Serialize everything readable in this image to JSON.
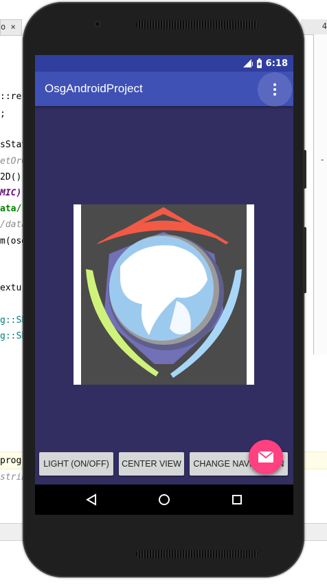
{
  "ide": {
    "left_tab": "o ×",
    "right_tab": "4",
    "right_panel_mark": "-",
    "code_lines": [
      {
        "text": "::re",
        "color": "#000000",
        "italic": false,
        "bold": false
      },
      {
        "text": ";",
        "color": "#000000",
        "italic": false,
        "bold": false
      },
      {
        "text": "sStat",
        "color": "#000000",
        "italic": false,
        "bold": false
      },
      {
        "text": "etOrC",
        "color": "#8c8c8c",
        "italic": true,
        "bold": false
      },
      {
        "text": "2D();",
        "color": "#000000",
        "italic": false,
        "bold": false
      },
      {
        "text": "MIC)",
        "color": "#660e7a",
        "italic": true,
        "bold": true
      },
      {
        "text": "ata/",
        "color": "#008000",
        "italic": false,
        "bold": true
      },
      {
        "text": "/data",
        "color": "#8c8c8c",
        "italic": true,
        "bold": false
      },
      {
        "text": "m(osg",
        "color": "#000000",
        "italic": false,
        "bold": false
      },
      {
        "text": "extur",
        "color": "#000000",
        "italic": false,
        "bold": false
      },
      {
        "text": "g::Sh",
        "color": "#008080",
        "italic": false,
        "bold": false
      },
      {
        "text": "g::Sh",
        "color": "#008080",
        "italic": false,
        "bold": false
      },
      {
        "text": "prog)",
        "color": "#000000",
        "italic": false,
        "bold": false
      },
      {
        "text": "stribu",
        "color": "#8c8c8c",
        "italic": true,
        "bold": false
      }
    ]
  },
  "status_bar": {
    "time": "6:18",
    "signal_icon": "signal-icon",
    "battery_icon": "battery-charging-icon"
  },
  "app_bar": {
    "title": "OsgAndroidProject",
    "menu_icon": "overflow-menu-icon"
  },
  "render_view": {
    "description_icon": "osg-globe-logo",
    "colors": {
      "background": "#4b4b4b",
      "roof": "#f25a45",
      "hexagon": "#7270b7",
      "left_swoosh": "#cff27a",
      "right_swoosh": "#a8d6f7",
      "globe": "#4a9ee0"
    }
  },
  "buttons": {
    "light": "LIGHT (ON/OFF)",
    "center": "CENTER VIEW",
    "change_nav": "CHANGE NAVIGATION"
  },
  "fab": {
    "icon": "email-icon",
    "color": "#ff4081"
  },
  "nav_bar": {
    "back_icon": "back-triangle-icon",
    "home_icon": "home-circle-icon",
    "recents_icon": "recents-square-icon"
  },
  "colors": {
    "status_bar": "#303f9f",
    "app_bar": "#3f51b5",
    "screen_bg": "#322e62"
  }
}
